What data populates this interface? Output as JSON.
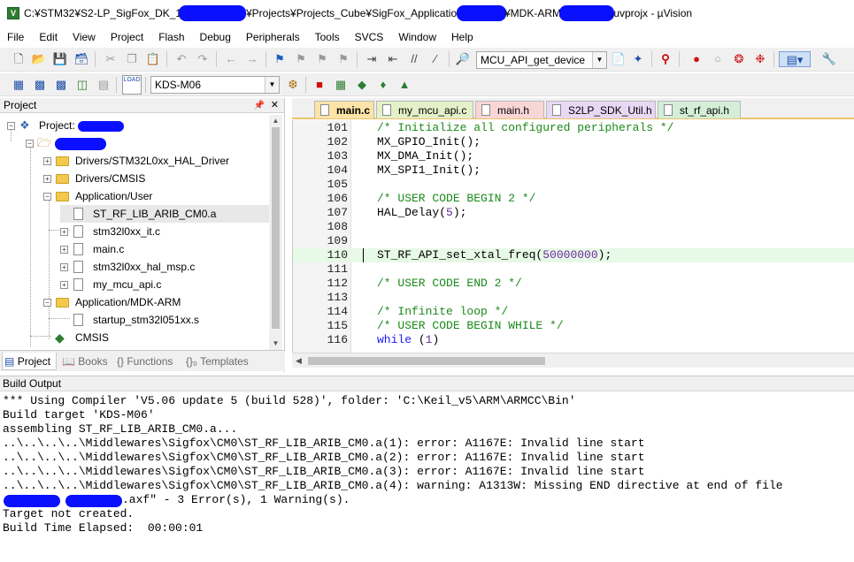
{
  "window": {
    "title_prefix": "C:¥STM32¥S2-LP_SigFox_DK_1.3.0",
    "title_mid1": "¥Projects¥Projects_Cube¥SigFox_Applications¥",
    "title_mid2": "¥MDK-ARM",
    "title_suffix": ".uvprojx - µVision"
  },
  "menu": [
    "File",
    "Edit",
    "View",
    "Project",
    "Flash",
    "Debug",
    "Peripherals",
    "Tools",
    "SVCS",
    "Window",
    "Help"
  ],
  "toolbar": {
    "function_combo": "MCU_API_get_device",
    "target_combo": "KDS-M06",
    "load_label": "LOAD"
  },
  "project_panel": {
    "title": "Project",
    "root_label": "Project:",
    "items": [
      {
        "label": "Drivers/STM32L0xx_HAL_Driver"
      },
      {
        "label": "Drivers/CMSIS"
      },
      {
        "label": "Application/User"
      },
      {
        "label": "ST_RF_LIB_ARIB_CM0.a"
      },
      {
        "label": "stm32l0xx_it.c"
      },
      {
        "label": "main.c"
      },
      {
        "label": "stm32l0xx_hal_msp.c"
      },
      {
        "label": "my_mcu_api.c"
      },
      {
        "label": "Application/MDK-ARM"
      },
      {
        "label": "startup_stm32l051xx.s"
      },
      {
        "label": "CMSIS"
      }
    ],
    "tabs": [
      "Project",
      "Books",
      "{} Functions",
      "{}₀ Templates"
    ]
  },
  "editor": {
    "tabs": [
      {
        "label": "main.c",
        "color": "#fce4a8"
      },
      {
        "label": "my_mcu_api.c",
        "color": "#e4f0c8"
      },
      {
        "label": "main.h",
        "color": "#f8d6d6"
      },
      {
        "label": "S2LP_SDK_Util.h",
        "color": "#e8d8f4"
      },
      {
        "label": "st_rf_api.h",
        "color": "#d4eed8"
      }
    ],
    "lines": [
      {
        "n": "101",
        "text": "/* Initialize all configured peripherals */",
        "kind": "comment"
      },
      {
        "n": "102",
        "text": "MX_GPIO_Init();",
        "kind": "plain"
      },
      {
        "n": "103",
        "text": "MX_DMA_Init();",
        "kind": "plain"
      },
      {
        "n": "104",
        "text": "MX_SPI1_Init();",
        "kind": "plain"
      },
      {
        "n": "105",
        "text": "",
        "kind": "plain"
      },
      {
        "n": "106",
        "text": "/* USER CODE BEGIN 2 */",
        "kind": "comment"
      },
      {
        "n": "107",
        "text": "HAL_Delay(",
        "num": "5",
        "tail": ");",
        "kind": "call"
      },
      {
        "n": "108",
        "text": "",
        "kind": "plain"
      },
      {
        "n": "109",
        "text": "",
        "kind": "plain"
      },
      {
        "n": "110",
        "text": "ST_RF_API_set_xtal_freq(",
        "num": "50000000",
        "tail": ");",
        "kind": "call"
      },
      {
        "n": "111",
        "text": "",
        "kind": "plain"
      },
      {
        "n": "112",
        "text": "/* USER CODE END 2 */",
        "kind": "comment"
      },
      {
        "n": "113",
        "text": "",
        "kind": "plain"
      },
      {
        "n": "114",
        "text": "/* Infinite loop */",
        "kind": "comment"
      },
      {
        "n": "115",
        "text": "/* USER CODE BEGIN WHILE */",
        "kind": "comment"
      },
      {
        "n": "116",
        "text": "while",
        "num": "1",
        "kind": "while"
      }
    ]
  },
  "build": {
    "title": "Build Output",
    "lines": [
      "*** Using Compiler 'V5.06 update 5 (build 528)', folder: 'C:\\Keil_v5\\ARM\\ARMCC\\Bin'",
      "Build target 'KDS-M06'",
      "assembling ST_RF_LIB_ARIB_CM0.a...",
      "..\\..\\..\\..\\Middlewares\\Sigfox\\CM0\\ST_RF_LIB_ARIB_CM0.a(1): error: A1167E: Invalid line start",
      "..\\..\\..\\..\\Middlewares\\Sigfox\\CM0\\ST_RF_LIB_ARIB_CM0.a(2): error: A1167E: Invalid line start",
      "..\\..\\..\\..\\Middlewares\\Sigfox\\CM0\\ST_RF_LIB_ARIB_CM0.a(3): error: A1167E: Invalid line start",
      "..\\..\\..\\..\\Middlewares\\Sigfox\\CM0\\ST_RF_LIB_ARIB_CM0.a(4): warning: A1313W: Missing END directive at end of file",
      ".axf\" - 3 Error(s), 1 Warning(s).",
      "Target not created.",
      "Build Time Elapsed:  00:00:01"
    ]
  },
  "colors": {
    "redaction": "#0a10ff",
    "comment": "#1a8a1a",
    "keyword": "#1a1aff",
    "number": "#6a2ca0",
    "highlight_line": "#e7f9e7"
  }
}
